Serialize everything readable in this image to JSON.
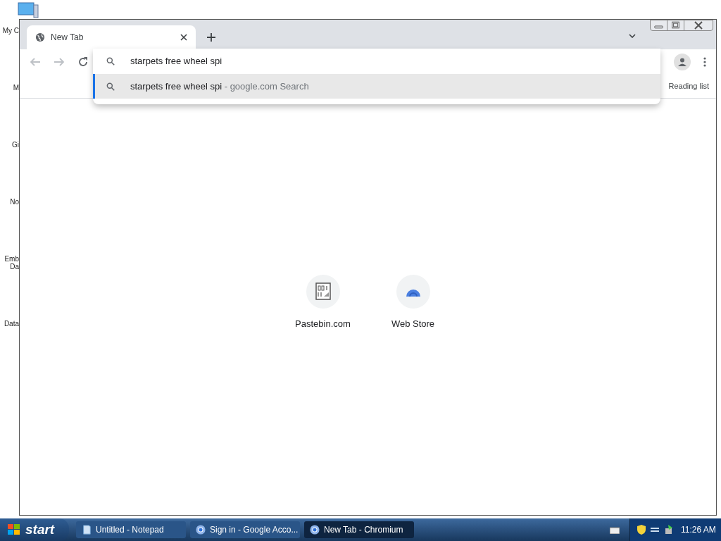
{
  "desktop_icons": [
    {
      "label": "My C"
    },
    {
      "label": "M"
    },
    {
      "label": "Gi"
    },
    {
      "label": "No"
    },
    {
      "label": "Emb Da"
    },
    {
      "label": "Data"
    }
  ],
  "browser": {
    "tabs": [
      {
        "title": "New Tab",
        "selected": true
      }
    ],
    "omnibox": {
      "value": "starpets free wheel spi"
    },
    "suggestions": [
      {
        "text": "starpets free wheel spi",
        "source": " - google.com Search",
        "selected": true
      }
    ],
    "reading_list": "Reading list",
    "shortcuts": [
      {
        "title": "Pastebin.com",
        "kind": "text-file"
      },
      {
        "title": "Web Store",
        "kind": "store"
      }
    ]
  },
  "taskbar": {
    "start": "start",
    "tasks": [
      {
        "title": "Untitled - Notepad",
        "kind": "notepad",
        "selected": false
      },
      {
        "title": "Sign in - Google Acco...",
        "kind": "chromium",
        "selected": false
      },
      {
        "title": "New Tab - Chromium",
        "kind": "chromium",
        "selected": true
      }
    ],
    "clock": "11:26 AM"
  }
}
